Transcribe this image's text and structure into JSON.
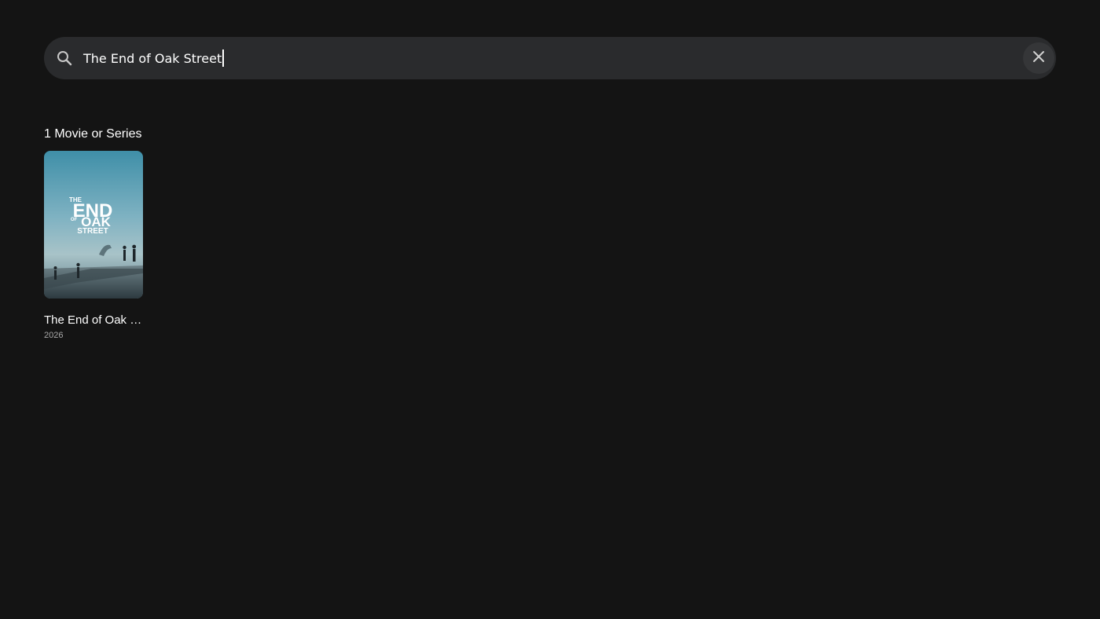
{
  "search": {
    "query": "The End of Oak Street",
    "icon": "search-icon",
    "clear_icon": "close-icon"
  },
  "results": {
    "heading": "1 Movie or Series",
    "items": [
      {
        "title": "The End of Oak Street",
        "display_title": "The End of Oak …",
        "year": "2026",
        "poster_text": [
          "THE",
          "END",
          "OF",
          "OAK",
          "STREET"
        ]
      }
    ]
  },
  "colors": {
    "background": "#141414",
    "search_bar": "#2a2b2d",
    "text_primary": "#ffffff",
    "text_secondary": "#a8a8a8"
  }
}
